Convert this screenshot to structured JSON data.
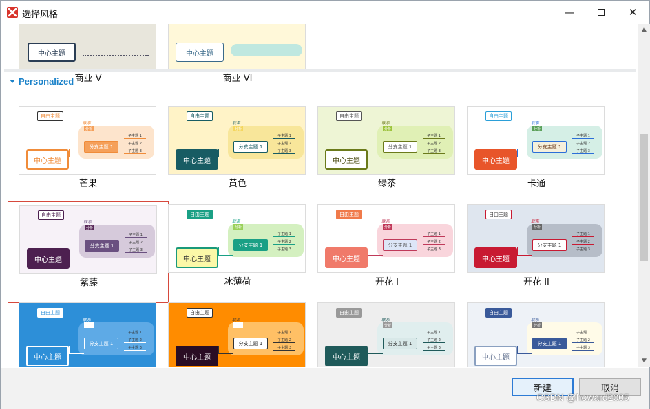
{
  "window": {
    "title": "选择风格",
    "app_icon": "xmind-logo-icon",
    "controls": [
      "minimize-icon",
      "maximize-icon",
      "close-icon"
    ]
  },
  "prev_section": {
    "themes": [
      {
        "name": "商业 V",
        "main": "中心主题"
      },
      {
        "name": "商业 VI",
        "main": "中心主题"
      }
    ]
  },
  "section": {
    "label": "Personalized",
    "expanded": true,
    "accent": "#1b82c9"
  },
  "labels": {
    "main": "中心主题",
    "floating": "自由主题",
    "branch": "分支主题 1",
    "relation": "联系",
    "summary": "分析",
    "sub1": "子主题 1",
    "sub2": "子主题 2",
    "sub3": "子主题 3"
  },
  "themes": [
    {
      "name": "芒果",
      "selected": false
    },
    {
      "name": "黄色",
      "selected": false
    },
    {
      "name": "绿茶",
      "selected": false
    },
    {
      "name": "卡通",
      "selected": false
    },
    {
      "name": "紫藤",
      "selected": true
    },
    {
      "name": "冰薄荷",
      "selected": false
    },
    {
      "name": "开花 I",
      "selected": false
    },
    {
      "name": "开花 II",
      "selected": false
    },
    {
      "name": "",
      "selected": false
    },
    {
      "name": "",
      "selected": false
    },
    {
      "name": "",
      "selected": false
    },
    {
      "name": "",
      "selected": false
    }
  ],
  "footer": {
    "ok_label": "新建",
    "cancel_label": "取消"
  },
  "watermark": "CSDN @howard2005"
}
